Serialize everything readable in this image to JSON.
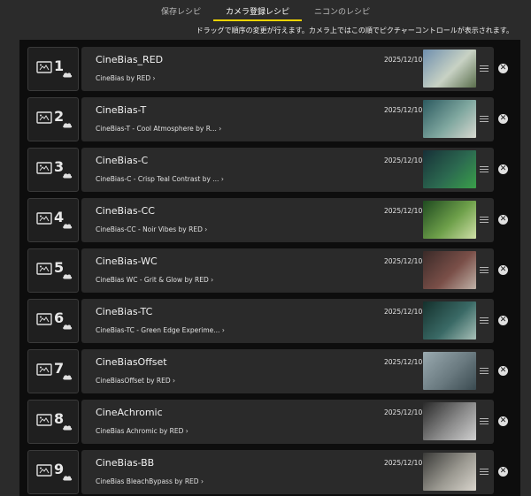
{
  "tabs": [
    {
      "label": "保存レシピ",
      "active": false
    },
    {
      "label": "カメラ登録レシピ",
      "active": true
    },
    {
      "label": "ニコンのレシピ",
      "active": false
    }
  ],
  "hint": "ドラッグで順序の変更が行えます。カメラ上ではこの順でピクチャーコントロールが表示されます。",
  "colors": {
    "accent": "#f2d400",
    "background": "#2b2b2b",
    "list_background": "#0d0d0d",
    "card": "#2a2a2a"
  },
  "icons": {
    "slot": "picture-control-icon",
    "cloud": "cloud-icon",
    "handle": "drag-handle-icon",
    "remove": "remove-icon",
    "link": "chevron-right-icon"
  },
  "recipes": [
    {
      "number": "1",
      "name": "CineBias_RED",
      "link": "CineBias by RED",
      "date": "2025/12/10",
      "thumb": [
        "#6f8fae",
        "#c8d2c4",
        "#5a6e4c"
      ]
    },
    {
      "number": "2",
      "name": "CineBias-T",
      "link": "CineBias-T - Cool Atmosphere by R...",
      "date": "2025/12/10",
      "thumb": [
        "#2c5a60",
        "#7fa79f",
        "#d8d8d0"
      ]
    },
    {
      "number": "3",
      "name": "CineBias-C",
      "link": "CineBias-C - Crisp Teal Contrast by ...",
      "date": "2025/12/10",
      "thumb": [
        "#173038",
        "#2c6a50",
        "#3aa04a"
      ]
    },
    {
      "number": "4",
      "name": "CineBias-CC",
      "link": "CineBias-CC - Noir Vibes by RED",
      "date": "2025/12/10",
      "thumb": [
        "#1f4a20",
        "#6ea04a",
        "#d0e0a8"
      ]
    },
    {
      "number": "5",
      "name": "CineBias-WC",
      "link": "CineBias WC - Grit & Glow by RED",
      "date": "2025/12/10",
      "thumb": [
        "#3a2a28",
        "#7a4f48",
        "#c0b2a8"
      ]
    },
    {
      "number": "6",
      "name": "CineBias-TC",
      "link": "CineBias-TC - Green Edge Experime...",
      "date": "2025/12/10",
      "thumb": [
        "#14302c",
        "#3a6a66",
        "#a8c0b8"
      ]
    },
    {
      "number": "7",
      "name": "CineBiasOffset",
      "link": "CineBiasOffset by RED",
      "date": "2025/12/10",
      "thumb": [
        "#9aaab0",
        "#6a7a80",
        "#3a4a50"
      ]
    },
    {
      "number": "8",
      "name": "CineAchromic",
      "link": "CineBias Achromic by RED",
      "date": "2025/12/10",
      "thumb": [
        "#2a2a2a",
        "#8a8a8a",
        "#d0d0d0"
      ]
    },
    {
      "number": "9",
      "name": "CineBias-BB",
      "link": "CineBias BleachBypass by RED",
      "date": "2025/12/10",
      "thumb": [
        "#3a3a38",
        "#9a9890",
        "#d8d4cc"
      ]
    }
  ]
}
